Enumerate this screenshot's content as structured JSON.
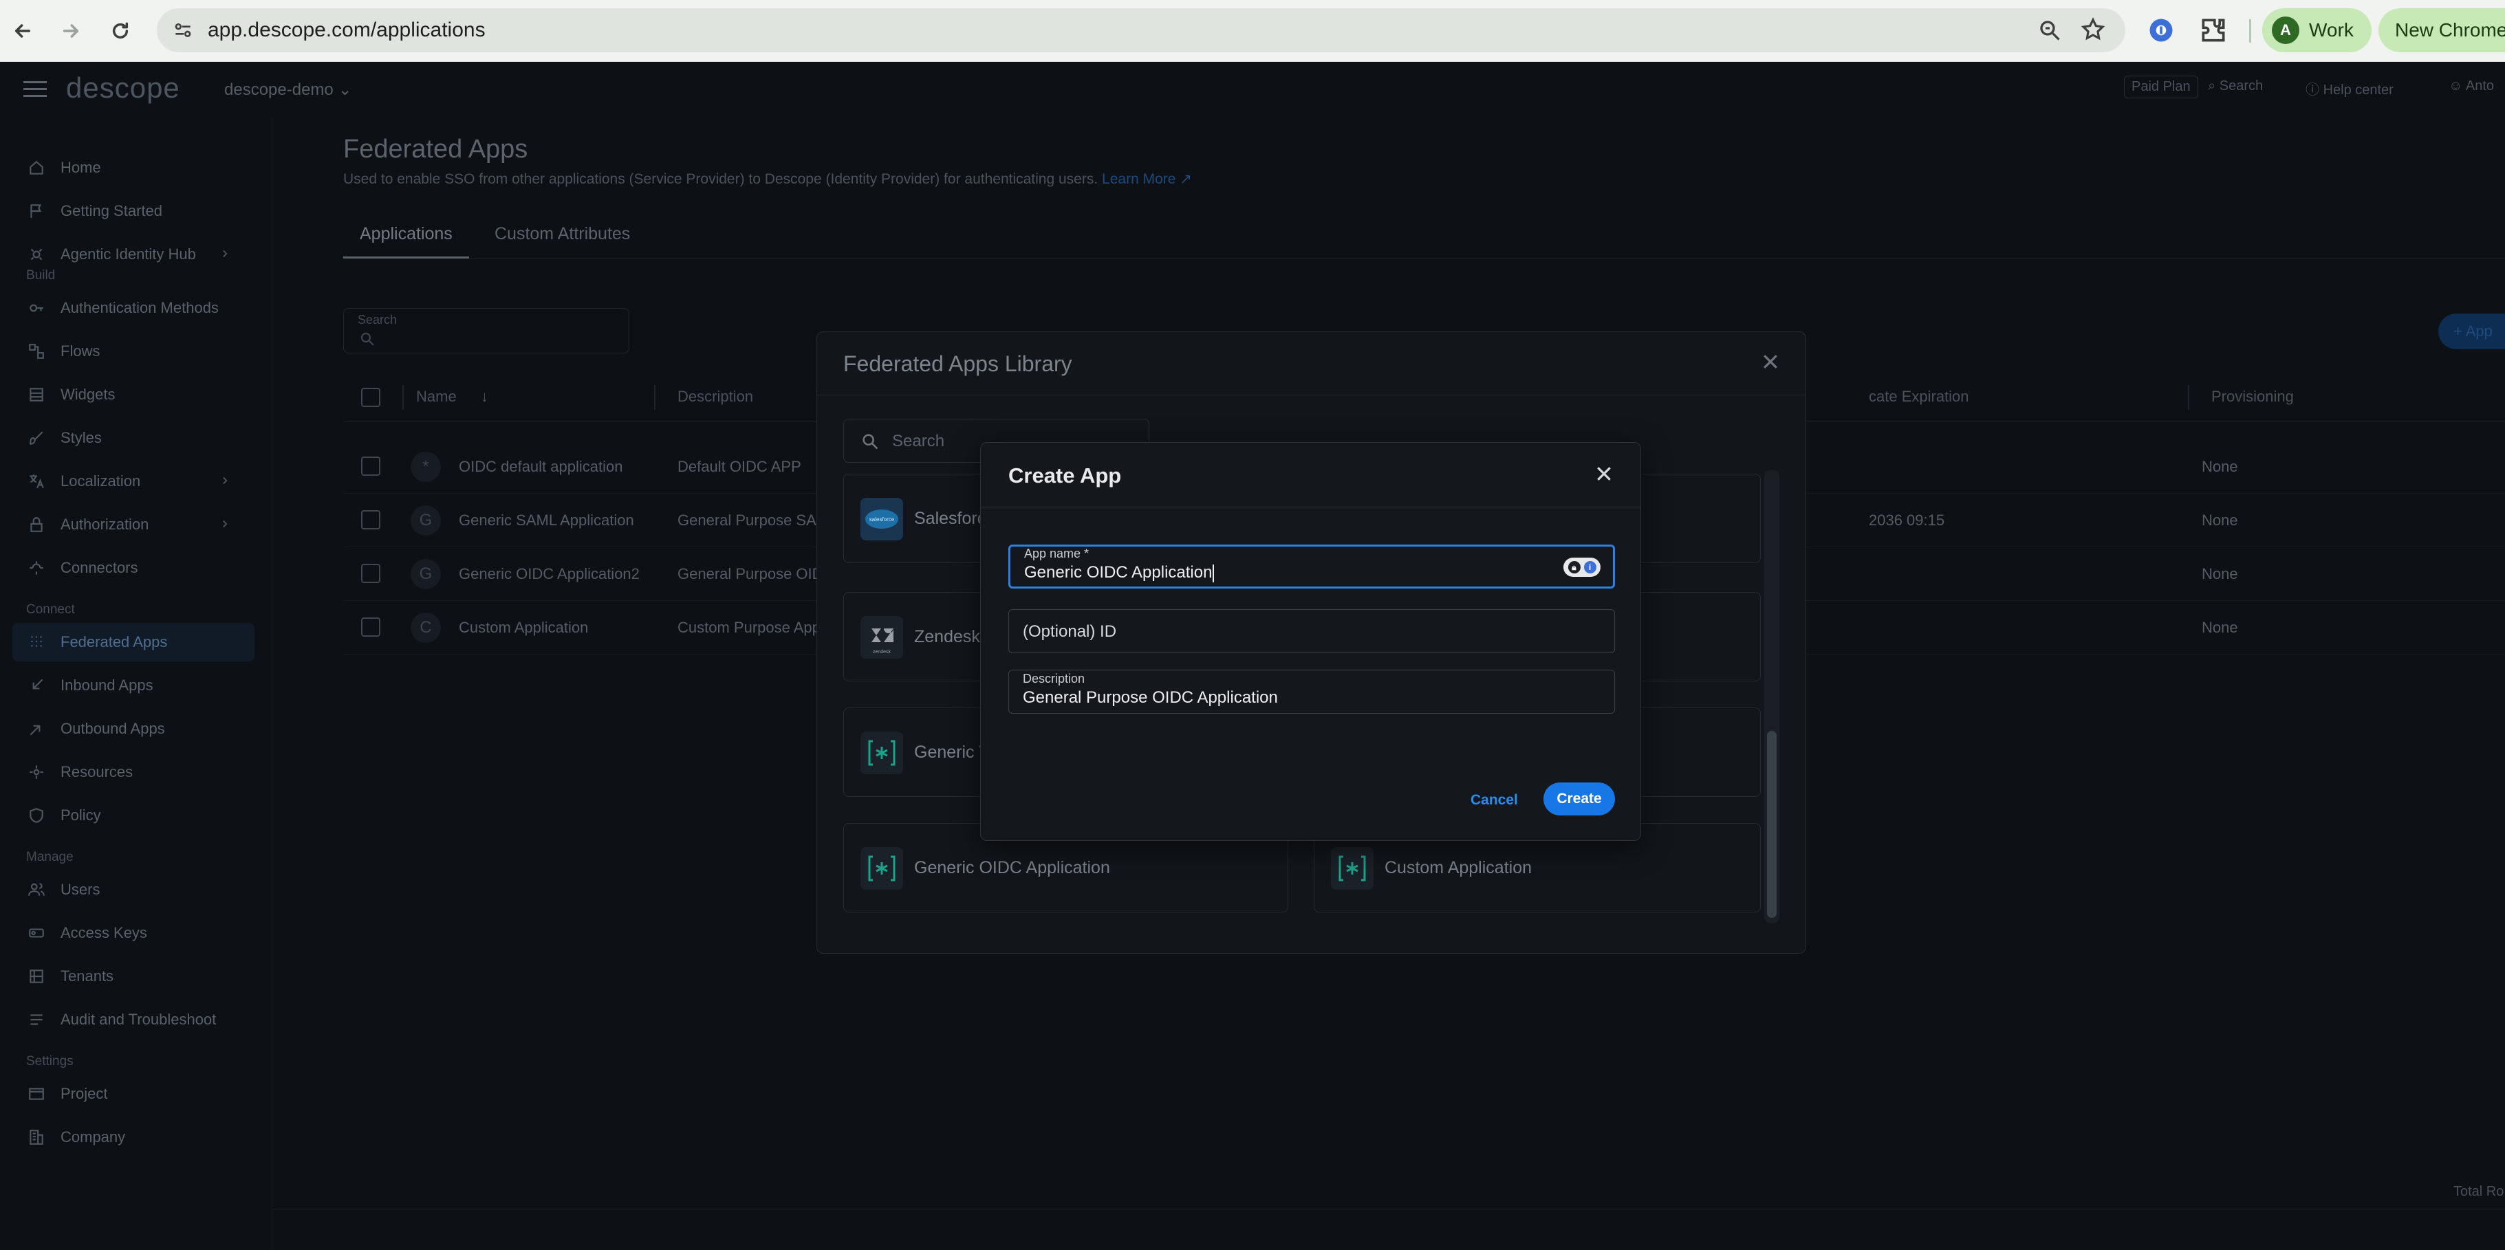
{
  "browser": {
    "url": "app.descope.com/applications",
    "profile_initial": "A",
    "profile_label": "Work",
    "new_chrome_label": "New Chrome"
  },
  "topbar": {
    "logo": "descope",
    "project": "descope-demo",
    "paid_plan": "Paid Plan",
    "search": "Search",
    "help": "Help center",
    "user": "Anto"
  },
  "sidebar": {
    "items_top": [
      {
        "label": "Home",
        "icon": "home-icon"
      },
      {
        "label": "Getting Started",
        "icon": "flag-icon"
      },
      {
        "label": "Agentic Identity Hub",
        "icon": "agent-icon",
        "chevron": true
      }
    ],
    "sections": [
      {
        "title": "Build",
        "items": [
          {
            "label": "Authentication Methods",
            "icon": "key-icon"
          },
          {
            "label": "Flows",
            "icon": "flow-icon"
          },
          {
            "label": "Widgets",
            "icon": "widget-icon"
          },
          {
            "label": "Styles",
            "icon": "brush-icon"
          },
          {
            "label": "Localization",
            "icon": "translate-icon",
            "chevron": true
          },
          {
            "label": "Authorization",
            "icon": "lock-icon",
            "chevron": true
          },
          {
            "label": "Connectors",
            "icon": "connector-icon"
          }
        ]
      },
      {
        "title": "Connect",
        "items": [
          {
            "label": "Federated Apps",
            "icon": "grid-icon",
            "active": true
          },
          {
            "label": "Inbound Apps",
            "icon": "inbound-icon"
          },
          {
            "label": "Outbound Apps",
            "icon": "outbound-icon"
          },
          {
            "label": "Resources",
            "icon": "resources-icon"
          },
          {
            "label": "Policy",
            "icon": "policy-icon"
          }
        ]
      },
      {
        "title": "Manage",
        "items": [
          {
            "label": "Users",
            "icon": "users-icon"
          },
          {
            "label": "Access Keys",
            "icon": "access-key-icon"
          },
          {
            "label": "Tenants",
            "icon": "tenants-icon"
          },
          {
            "label": "Audit and Troubleshoot",
            "icon": "audit-icon"
          }
        ]
      },
      {
        "title": "Settings",
        "items": [
          {
            "label": "Project",
            "icon": "project-icon"
          },
          {
            "label": "Company",
            "icon": "company-icon"
          }
        ]
      }
    ]
  },
  "page": {
    "title": "Federated Apps",
    "subtitle": "Used to enable SSO from other applications (Service Provider) to Descope (Identity Provider) for authenticating users.",
    "learn_more": "Learn More",
    "tabs": [
      "Applications",
      "Custom Attributes"
    ],
    "search_label": "Search",
    "add_app": "+ App",
    "columns": {
      "name": "Name",
      "description": "Description",
      "cert_expiration": "cate Expiration",
      "provisioning": "Provisioning"
    },
    "rows": [
      {
        "icon": "*",
        "name": "OIDC default application",
        "description": "Default OIDC APP",
        "cert": "",
        "provisioning": "None"
      },
      {
        "icon": "G",
        "name": "Generic SAML Application",
        "description": "General Purpose SAML",
        "cert": "2036 09:15",
        "provisioning": "None"
      },
      {
        "icon": "G",
        "name": "Generic OIDC Application2",
        "description": "General Purpose OIDC",
        "cert": "",
        "provisioning": "None"
      },
      {
        "icon": "C",
        "name": "Custom Application",
        "description": "Custom Purpose Appli",
        "cert": "",
        "provisioning": "None"
      }
    ],
    "total_rows": "Total Ro"
  },
  "library": {
    "title": "Federated Apps Library",
    "search_placeholder": "Search",
    "cards": [
      {
        "name": "Salesforc",
        "logo": "salesforce-logo"
      },
      {
        "name": "Zendesk",
        "logo": "zendesk-logo"
      },
      {
        "name": "Generic V",
        "logo": "descope-logo"
      },
      {
        "name": "Generic OIDC Application",
        "logo": "descope-logo"
      },
      {
        "name": "Custom Application",
        "logo": "descope-logo"
      }
    ]
  },
  "create_app": {
    "title": "Create App",
    "app_name_label": "App name *",
    "app_name_value": "Generic OIDC Application",
    "id_placeholder": "(Optional) ID",
    "description_label": "Description",
    "description_value": "General Purpose OIDC Application",
    "cancel": "Cancel",
    "create": "Create"
  },
  "colors": {
    "accent": "#1877e6",
    "focus_border": "#2d7fe0",
    "profile_chip": "#c6e9b6",
    "backdrop": "#0d1014"
  }
}
